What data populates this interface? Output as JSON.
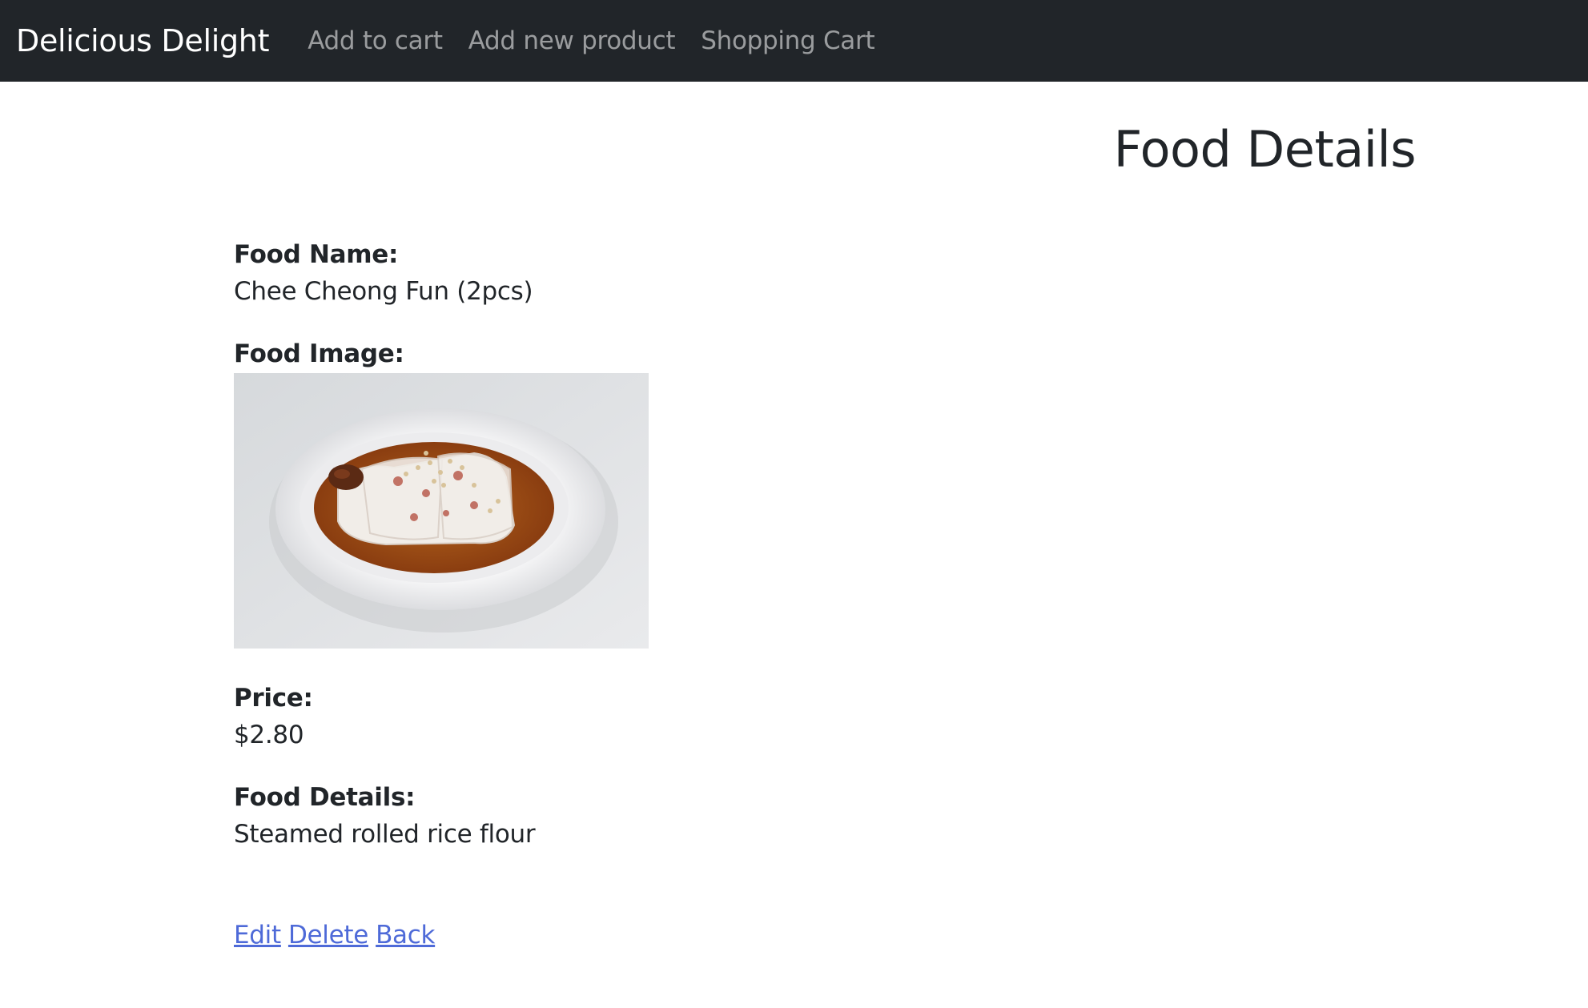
{
  "navbar": {
    "brand": "Delicious Delight",
    "links": [
      "Add to cart",
      "Add new product",
      "Shopping Cart"
    ]
  },
  "page": {
    "title": "Food Details"
  },
  "details": {
    "name_label": "Food Name:",
    "name_value": "Chee Cheong Fun (2pcs)",
    "image_label": "Food Image:",
    "price_label": "Price:",
    "price_value": "$2.80",
    "description_label": "Food Details:",
    "description_value": "Steamed rolled rice flour"
  },
  "actions": {
    "edit": "Edit",
    "delete": "Delete",
    "back": "Back"
  },
  "colors": {
    "navbar_bg": "#212529",
    "link": "#4e6ad8"
  }
}
